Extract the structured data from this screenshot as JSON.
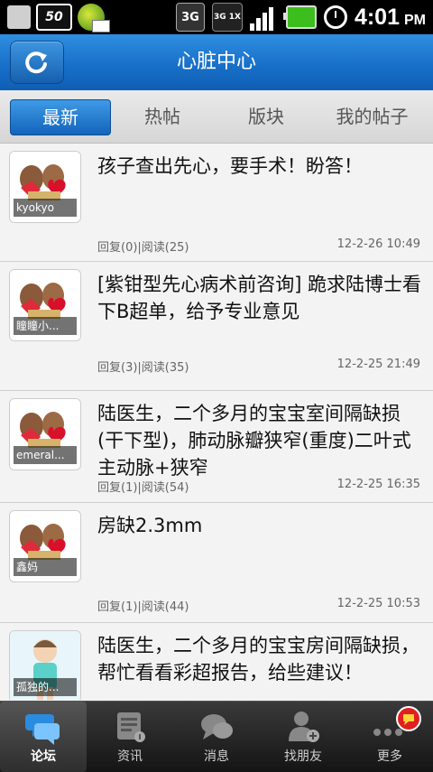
{
  "status_bar": {
    "signal_badge": "50",
    "network_3g": "3G",
    "network_label": "3G 1X",
    "time": "4:01",
    "ampm": "PM"
  },
  "header": {
    "title": "心脏中心"
  },
  "tabs": [
    {
      "label": "最新",
      "active": true
    },
    {
      "label": "热帖",
      "active": false
    },
    {
      "label": "版块",
      "active": false
    },
    {
      "label": "我的帖子",
      "active": false
    }
  ],
  "posts": [
    {
      "user": "kyokyo",
      "title": "孩子查出先心，要手术！盼答！",
      "meta": "回复(0)|阅读(25)",
      "time": "12-2-26 10:49",
      "avatar": "pets-icon"
    },
    {
      "user": "瞳瞳小...",
      "title": "[紫钳型先心病术前咨询] 跪求陆博士看下B超单，给予专业意见",
      "meta": "回复(3)|阅读(35)",
      "time": "12-2-25 21:49",
      "avatar": "pets-icon"
    },
    {
      "user": "emeral...",
      "title": "陆医生，二个多月的宝宝室间隔缺损(干下型)，肺动脉瓣狭窄(重度)二叶式主动脉+狭窄",
      "meta": "回复(1)|阅读(54)",
      "time": "12-2-25 16:35",
      "avatar": "pets-icon"
    },
    {
      "user": "鑫妈",
      "title": "房缺2.3mm",
      "meta": "回复(1)|阅读(44)",
      "time": "12-2-25 10:53",
      "avatar": "pets-icon"
    },
    {
      "user": "孤独的...",
      "title": "陆医生，二个多月的宝宝房间隔缺损，帮忙看看彩超报告，给些建议！",
      "meta": "",
      "time": "",
      "avatar": "doll-icon"
    }
  ],
  "bottom_nav": [
    {
      "label": "论坛",
      "icon": "forum-icon",
      "active": true
    },
    {
      "label": "资讯",
      "icon": "news-icon",
      "active": false
    },
    {
      "label": "消息",
      "icon": "message-icon",
      "active": false
    },
    {
      "label": "找朋友",
      "icon": "find-friend-icon",
      "active": false
    },
    {
      "label": "更多",
      "icon": "more-icon",
      "active": false
    }
  ],
  "colors": {
    "header_blue": "#1870c9",
    "active_tab": "#1f78cf",
    "badge_red": "#e02020"
  }
}
